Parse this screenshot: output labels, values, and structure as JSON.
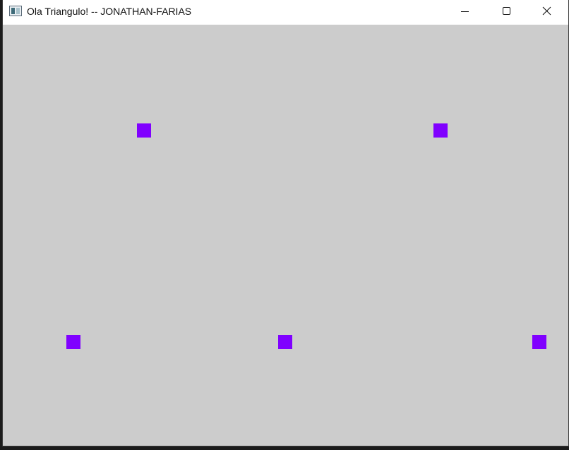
{
  "window": {
    "title": "Ola Triangulo! -- JONATHAN-FARIAS",
    "icon": "app-window-icon",
    "controls": {
      "minimize": "minimize-icon",
      "maximize": "maximize-icon",
      "close": "close-icon"
    }
  },
  "canvas": {
    "background_color": "#cccccc",
    "point_color": "#8000ff",
    "point_count": 5
  }
}
